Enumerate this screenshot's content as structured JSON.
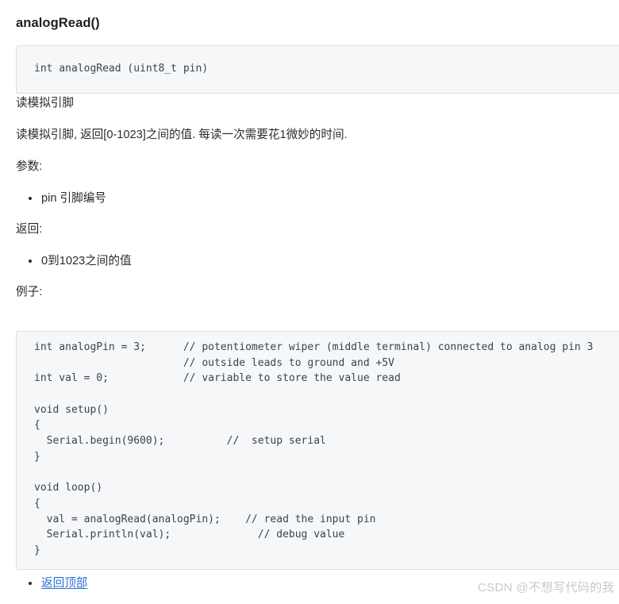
{
  "heading": "analogRead()",
  "signature_code": "int analogRead (uint8_t pin)",
  "paragraphs": {
    "title": "读模拟引脚",
    "description": "读模拟引脚, 返回[0-1023]之间的值. 每读一次需要花1微妙的时间.",
    "params_label": "参数:",
    "returns_label": "返回:",
    "example_label": "例子:"
  },
  "bullets": {
    "pin": "pin 引脚编号",
    "return_value": "0到1023之间的值",
    "back_to_top": "返回顶部"
  },
  "example_code_lines": [
    "int analogPin = 3;      // potentiometer wiper (middle terminal) connected to analog pin 3",
    "                        // outside leads to ground and +5V",
    "int val = 0;            // variable to store the value read",
    "",
    "void setup()",
    "{",
    "  Serial.begin(9600);          //  setup serial",
    "}",
    "",
    "void loop()",
    "{",
    "  val = analogRead(analogPin);    // read the input pin",
    "  Serial.println(val);              // debug value",
    "}"
  ],
  "watermark": "CSDN @不想写代码的我",
  "colors": {
    "link": "#2a6fd6",
    "code_background": "#f6f7f8",
    "code_border": "#dcdee0",
    "code_text": "#3b4351",
    "body_text": "#2b2b2b",
    "heading_text": "#1b1f23",
    "watermark_text": "#c9c9c9"
  }
}
